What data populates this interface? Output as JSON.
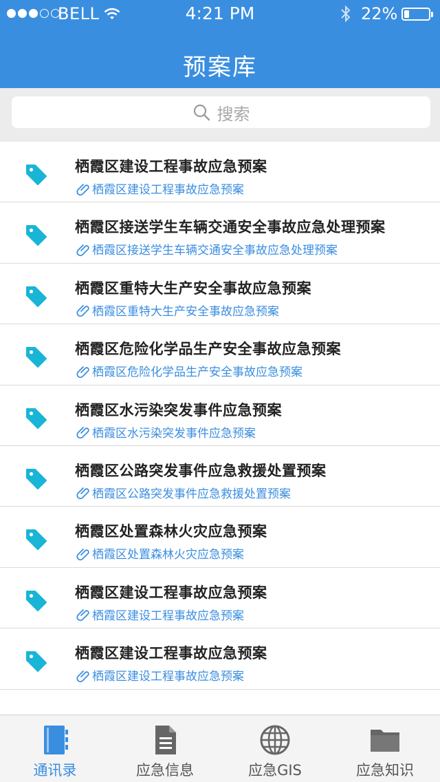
{
  "status": {
    "carrier": "BELL",
    "time": "4:21 PM",
    "battery": "22%",
    "battery_level": 0.22,
    "signal_strength": 3
  },
  "header": {
    "title": "预案库"
  },
  "search": {
    "placeholder": "搜索"
  },
  "plans": [
    {
      "title": "栖霞区建设工程事故应急预案",
      "link": "栖霞区建设工程事故应急预案"
    },
    {
      "title": "栖霞区接送学生车辆交通安全事故应急处理预案",
      "link": "栖霞区接送学生车辆交通安全事故应急处理预案"
    },
    {
      "title": "栖霞区重特大生产安全事故应急预案",
      "link": "栖霞区重特大生产安全事故应急预案"
    },
    {
      "title": "栖霞区危险化学品生产安全事故应急预案",
      "link": "栖霞区危险化学品生产安全事故应急预案"
    },
    {
      "title": "栖霞区水污染突发事件应急预案",
      "link": "栖霞区水污染突发事件应急预案"
    },
    {
      "title": "栖霞区公路突发事件应急救援处置预案",
      "link": "栖霞区公路突发事件应急救援处置预案"
    },
    {
      "title": "栖霞区处置森林火灾应急预案",
      "link": "栖霞区处置森林火灾应急预案"
    },
    {
      "title": "栖霞区建设工程事故应急预案",
      "link": "栖霞区建设工程事故应急预案"
    },
    {
      "title": "栖霞区建设工程事故应急预案",
      "link": "栖霞区建设工程事故应急预案"
    }
  ],
  "tabs": [
    {
      "label": "通讯录",
      "icon": "contacts-book-icon",
      "active": true
    },
    {
      "label": "应急信息",
      "icon": "document-icon",
      "active": false
    },
    {
      "label": "应急GIS",
      "icon": "globe-icon",
      "active": false
    },
    {
      "label": "应急知识",
      "icon": "folder-icon",
      "active": false
    }
  ],
  "colors": {
    "accent": "#3a8ee0",
    "tag": "#19b5d6",
    "tab_inactive": "#555555"
  }
}
